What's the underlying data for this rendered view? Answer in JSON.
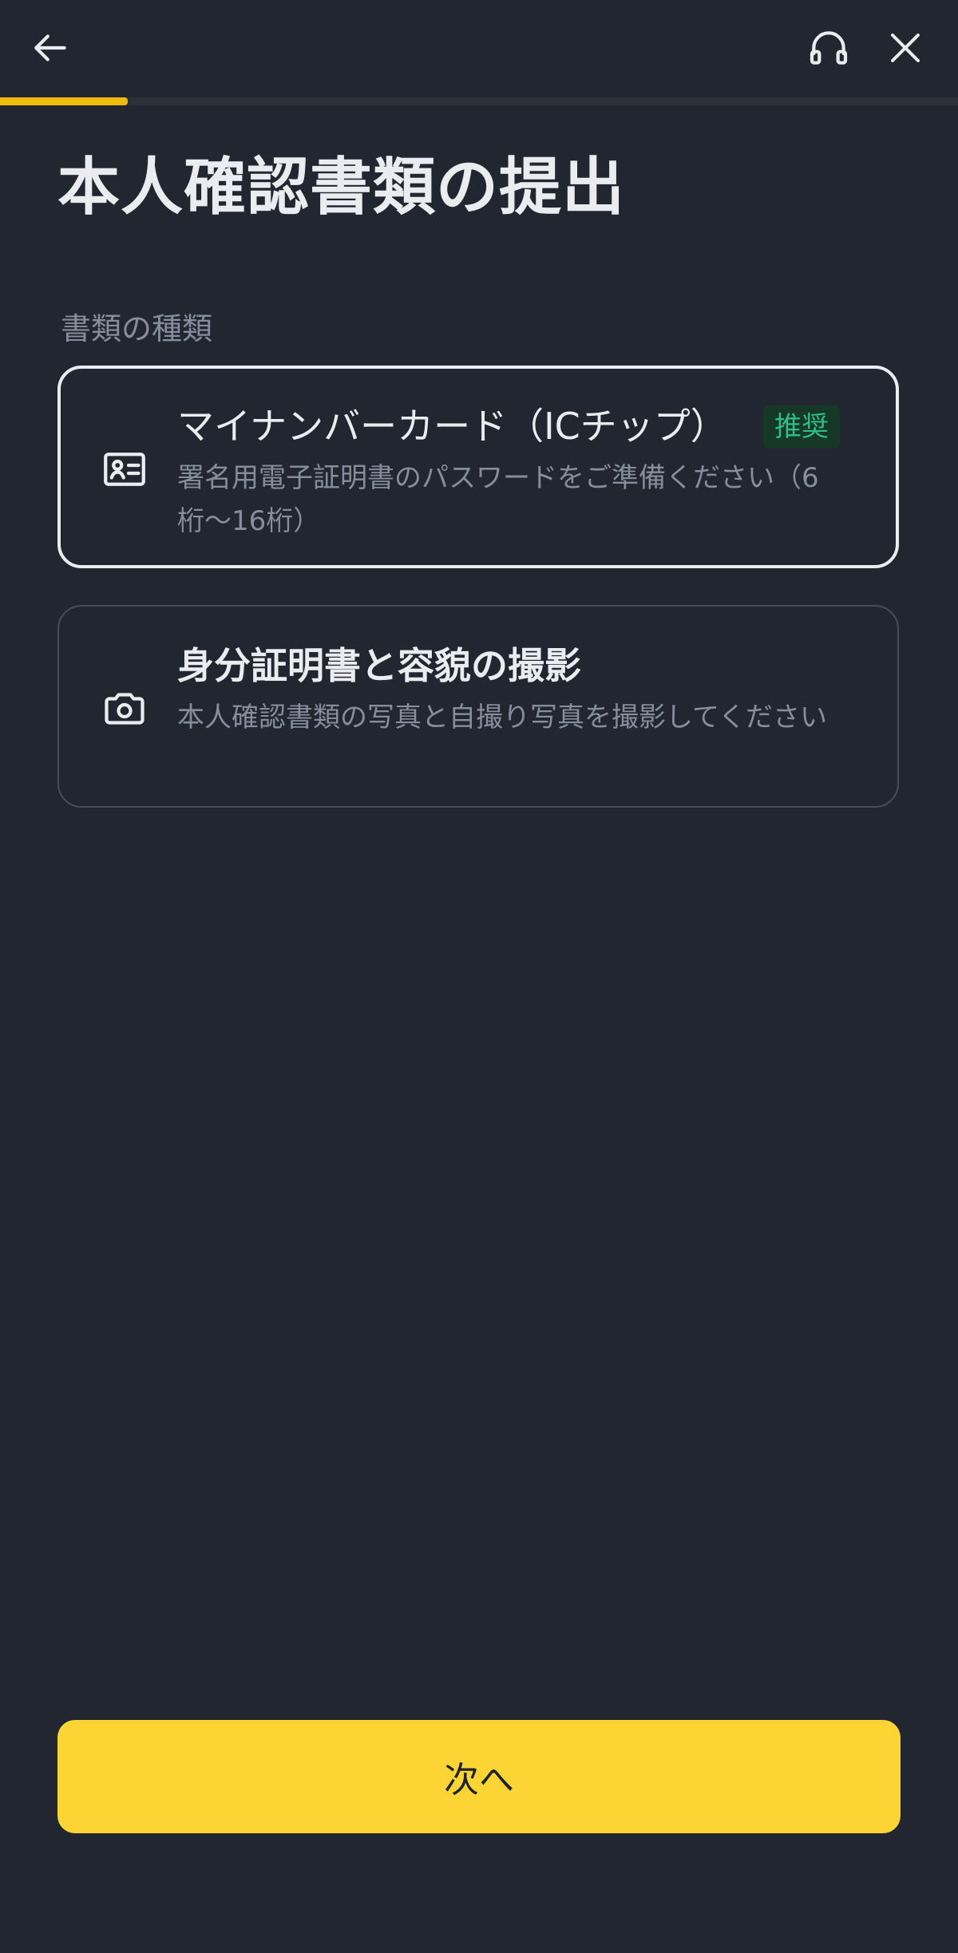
{
  "header": {
    "back_icon": "arrow-left-icon",
    "support_icon": "headset-icon",
    "close_icon": "close-icon",
    "progress_fraction": 0.133,
    "progress_color": "#f0b90b"
  },
  "page": {
    "title": "本人確認書類の提出"
  },
  "document_types": {
    "label": "書類の種類",
    "options": [
      {
        "icon": "id-card-icon",
        "title": "マイナンバーカード（ICチップ）",
        "badge": "推奨",
        "description": "署名用電子証明書のパスワードをご準備ください（6桁〜16桁）",
        "selected": true
      },
      {
        "icon": "camera-icon",
        "title": "身分証明書と容貌の撮影",
        "description": "本人確認書類の写真と自撮り写真を撮影してください",
        "selected": false
      }
    ]
  },
  "footer": {
    "next_label": "次へ"
  },
  "colors": {
    "background": "#222630",
    "accent": "#fcd535",
    "badge_text": "#2ebd85",
    "badge_bg": "#163826",
    "muted_text": "#848e9c"
  }
}
